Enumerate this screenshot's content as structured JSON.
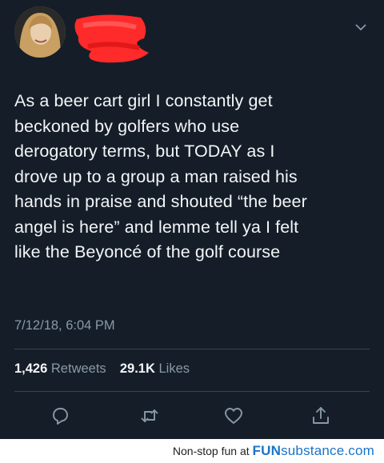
{
  "tweet": {
    "text": "As a beer cart girl I constantly get\nbeckoned by golfers who use\nderogatory terms, but TODAY as I\ndrove up to a group a man raised his\nhands in praise and shouted “the beer\nangel is here” and lemme tell ya I felt\nlike the Beyoncé of the golf course",
    "timestamp": "7/12/18, 6:04 PM",
    "retweets_count": "1,426",
    "retweets_label": "Retweets",
    "likes_count": "29.1K",
    "likes_label": "Likes"
  },
  "actions": {
    "reply_icon": "reply-icon",
    "retweet_icon": "retweet-icon",
    "like_icon": "heart-icon",
    "share_icon": "share-icon"
  },
  "colors": {
    "background": "#151e28",
    "text": "#f3f6f8",
    "muted": "#8899a6",
    "redaction": "#ff2a2a"
  },
  "footer": {
    "caption": "Non-stop fun at",
    "brand_fun": "FUN",
    "brand_sub": "substance",
    "brand_domain": ".com"
  }
}
